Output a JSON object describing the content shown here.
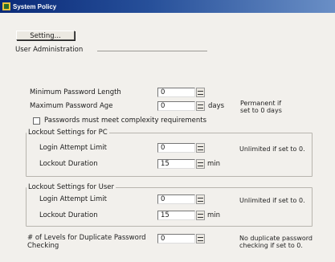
{
  "window": {
    "title": "System Policy",
    "title_icon": "app-icon"
  },
  "tab_button": {
    "label": "Setting..."
  },
  "section": {
    "title": "User Administration"
  },
  "password": {
    "min_length_label": "Minimum Password Length",
    "min_length_value": "0",
    "max_age_label": "Maximum Password Age",
    "max_age_value": "0",
    "max_age_unit": "days",
    "max_age_note": "Permanent if set to 0 days",
    "complexity_label": "Passwords must meet complexity requirements",
    "complexity_checked": false
  },
  "lockout_pc": {
    "title": "Lockout Settings for PC",
    "attempt_label": "Login Attempt Limit",
    "attempt_value": "0",
    "attempt_note": "Unlimited if set to 0.",
    "duration_label": "Lockout Duration",
    "duration_value": "15",
    "duration_unit": "min"
  },
  "lockout_user": {
    "title": "Lockout Settings for User",
    "attempt_label": "Login Attempt Limit",
    "attempt_value": "0",
    "attempt_note": "Unlimited if set to 0.",
    "duration_label": "Lockout Duration",
    "duration_value": "15",
    "duration_unit": "min"
  },
  "duplicate": {
    "label": "# of Levels for Duplicate Password Checking",
    "value": "0",
    "note": "No duplicate password checking if set to 0."
  }
}
